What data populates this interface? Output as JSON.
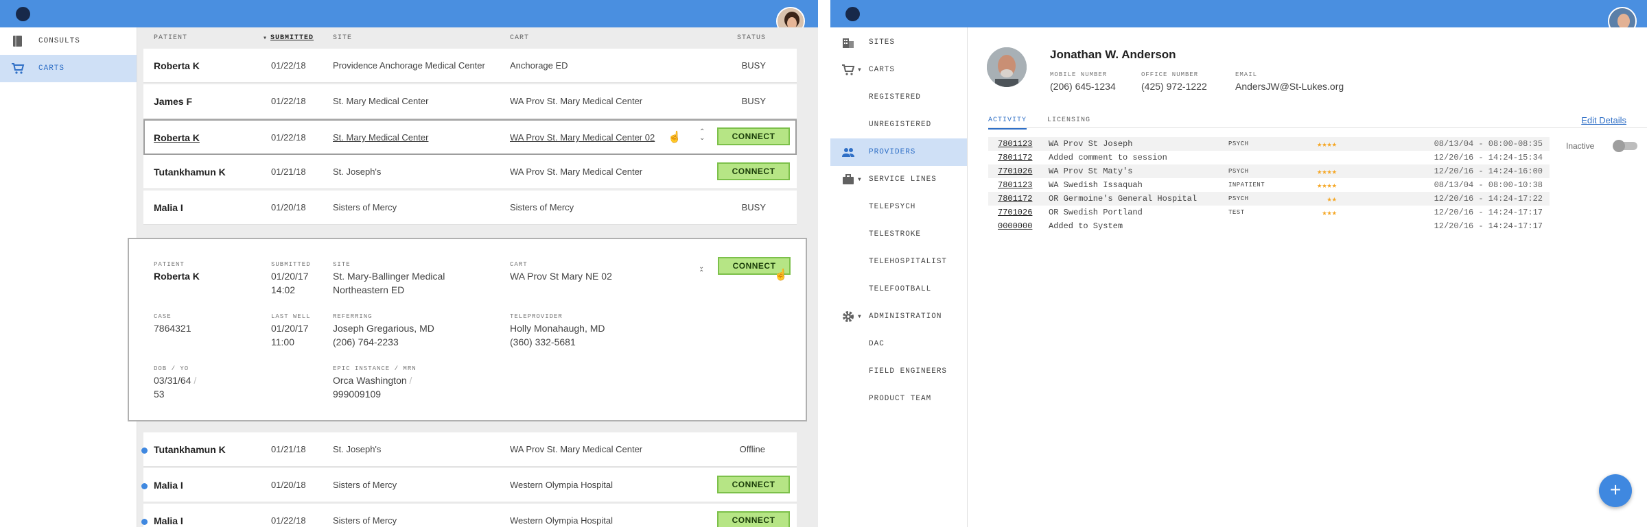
{
  "left_app": {
    "sidebar": [
      {
        "label": "CONSULTS",
        "icon": "book-icon",
        "selected": false
      },
      {
        "label": "CARTS",
        "icon": "cart-icon",
        "selected": true
      }
    ],
    "table_headers": {
      "patient": "PATIENT",
      "submitted": "SUBMITTED",
      "site": "SITE",
      "cart": "CART",
      "status": "STATUS"
    },
    "rows_top": [
      {
        "patient": "Roberta K",
        "date": "01/22/18",
        "site": "Providence Anchorage Medical Center",
        "cart": "Anchorage ED",
        "status": "BUSY"
      },
      {
        "patient": "James F",
        "date": "01/22/18",
        "site": "St. Mary Medical Center",
        "cart": "WA Prov St. Mary Medical Center",
        "status": "BUSY"
      },
      {
        "patient": "Roberta K",
        "date": "01/22/18",
        "site": "St. Mary Medical Center",
        "cart": "WA Prov St. Mary Medical Center 02",
        "status": "CONNECT"
      },
      {
        "patient": "Tutankhamun K",
        "date": "01/21/18",
        "site": "St. Joseph's",
        "cart": "WA Prov St. Mary Medical Center",
        "status": "CONNECT"
      },
      {
        "patient": "Malia I",
        "date": "01/20/18",
        "site": "Sisters of Mercy",
        "cart": "Sisters of Mercy",
        "status": "BUSY"
      }
    ],
    "detail": {
      "patient_label": "PATIENT",
      "patient": "Roberta K",
      "submitted_label": "SUBMITTED",
      "submitted_date": "01/20/17",
      "submitted_time": "14:02",
      "site_label": "SITE",
      "site_line1": "St. Mary-Ballinger Medical",
      "site_line2": "Northeastern ED",
      "cart_label": "CART",
      "cart": "WA Prov St Mary NE 02",
      "case_label": "CASE",
      "case": "7864321",
      "last_well_label": "LAST WELL",
      "last_well_date": "01/20/17",
      "last_well_time": "11:00",
      "referring_label": "REFERRING",
      "referring_name": "Joseph Gregarious, MD",
      "referring_phone": "(206) 764-2233",
      "teleprovider_label": "TELEPROVIDER",
      "teleprovider_name": "Holly Monahaugh, MD",
      "teleprovider_phone": "(360) 332-5681",
      "dob_label": "DOB / YO",
      "dob": "03/31/64",
      "slash": "/",
      "yo": "53",
      "epic_label": "EPIC INSTANCE / MRN",
      "epic": "Orca Washington",
      "mrn": "999009109",
      "connect": "CONNECT"
    },
    "rows_bottom": [
      {
        "patient": "Tutankhamun K",
        "date": "01/21/18",
        "site": "St. Joseph's",
        "cart": "WA Prov St. Mary Medical Center",
        "status": "Offline"
      },
      {
        "patient": "Malia I",
        "date": "01/20/18",
        "site": "Sisters of Mercy",
        "cart": "Western Olympia Hospital",
        "status": "CONNECT"
      },
      {
        "patient": "Malia I",
        "date": "01/22/18",
        "site": "Sisters of Mercy",
        "cart": "Western Olympia Hospital",
        "status": "CONNECT"
      }
    ]
  },
  "right_app": {
    "sidebar": [
      {
        "label": "SITES",
        "icon": "building-icon",
        "selected": false
      },
      {
        "label": "CARTS",
        "icon": "cart-icon",
        "selected": false,
        "expand": true
      },
      {
        "label": "REGISTERED",
        "sub": true
      },
      {
        "label": "UNREGISTERED",
        "sub": true
      },
      {
        "label": "PROVIDERS",
        "icon": "people-icon",
        "selected": true
      },
      {
        "label": "SERVICE LINES",
        "icon": "briefcase-icon",
        "expand": true
      },
      {
        "label": "TELEPSYCH",
        "sub": true
      },
      {
        "label": "TELESTROKE",
        "sub": true
      },
      {
        "label": "TELEHOSPITALIST",
        "sub": true
      },
      {
        "label": "TELEFOOTBALL",
        "sub": true
      },
      {
        "label": "ADMINISTRATION",
        "icon": "gear-icon",
        "expand": true
      },
      {
        "label": "DAC",
        "sub": true
      },
      {
        "label": "FIELD ENGINEERS",
        "sub": true
      },
      {
        "label": "PRODUCT TEAM",
        "sub": true
      }
    ],
    "profile": {
      "name": "Jonathan W. Anderson",
      "mobile_label": "MOBILE NUMBER",
      "mobile": "(206) 645-1234",
      "office_label": "OFFICE NUMBER",
      "office": "(425) 972-1222",
      "email_label": "EMAIL",
      "email": "AndersJW@St-Lukes.org"
    },
    "tabs": [
      {
        "label": "ACTIVITY",
        "active": true
      },
      {
        "label": "LICENSING",
        "active": false
      }
    ],
    "edit_details": "Edit Details",
    "inactive_label": "Inactive",
    "activity": [
      {
        "id": "7801123",
        "desc": "WA Prov St Joseph",
        "tag": "PSYCH",
        "stars": "★★★★",
        "time": "08/13/04 - 08:00-08:35"
      },
      {
        "id": "7801172",
        "desc": "Added comment to session",
        "tag": "",
        "stars": "",
        "time": "12/20/16 - 14:24-15:34"
      },
      {
        "id": "7701026",
        "desc": "WA Prov St Maty's",
        "tag": "PSYCH",
        "stars": "★★★★",
        "time": "12/20/16 - 14:24-16:00"
      },
      {
        "id": "7801123",
        "desc": "WA Swedish Issaquah",
        "tag": "INPATIENT",
        "stars": "★★★★",
        "time": "08/13/04 - 08:00-10:38"
      },
      {
        "id": "7801172",
        "desc": "OR Germoine's General Hospital",
        "tag": "PSYCH",
        "stars": "★★",
        "time": "12/20/16 - 14:24-17:22"
      },
      {
        "id": "7701026",
        "desc": "OR Swedish Portland",
        "tag": "TEST",
        "stars": "★★★",
        "time": "12/20/16 - 14:24-17:17"
      },
      {
        "id": "0000000",
        "desc": "Added to System",
        "tag": "",
        "stars": "",
        "time": "12/20/16 - 14:24-17:17"
      }
    ],
    "fab": "+"
  },
  "colors": {
    "topbar": "#4a8fe0",
    "accent": "#2f6fc6",
    "connect": "#b6e585",
    "star": "#f5a623"
  }
}
